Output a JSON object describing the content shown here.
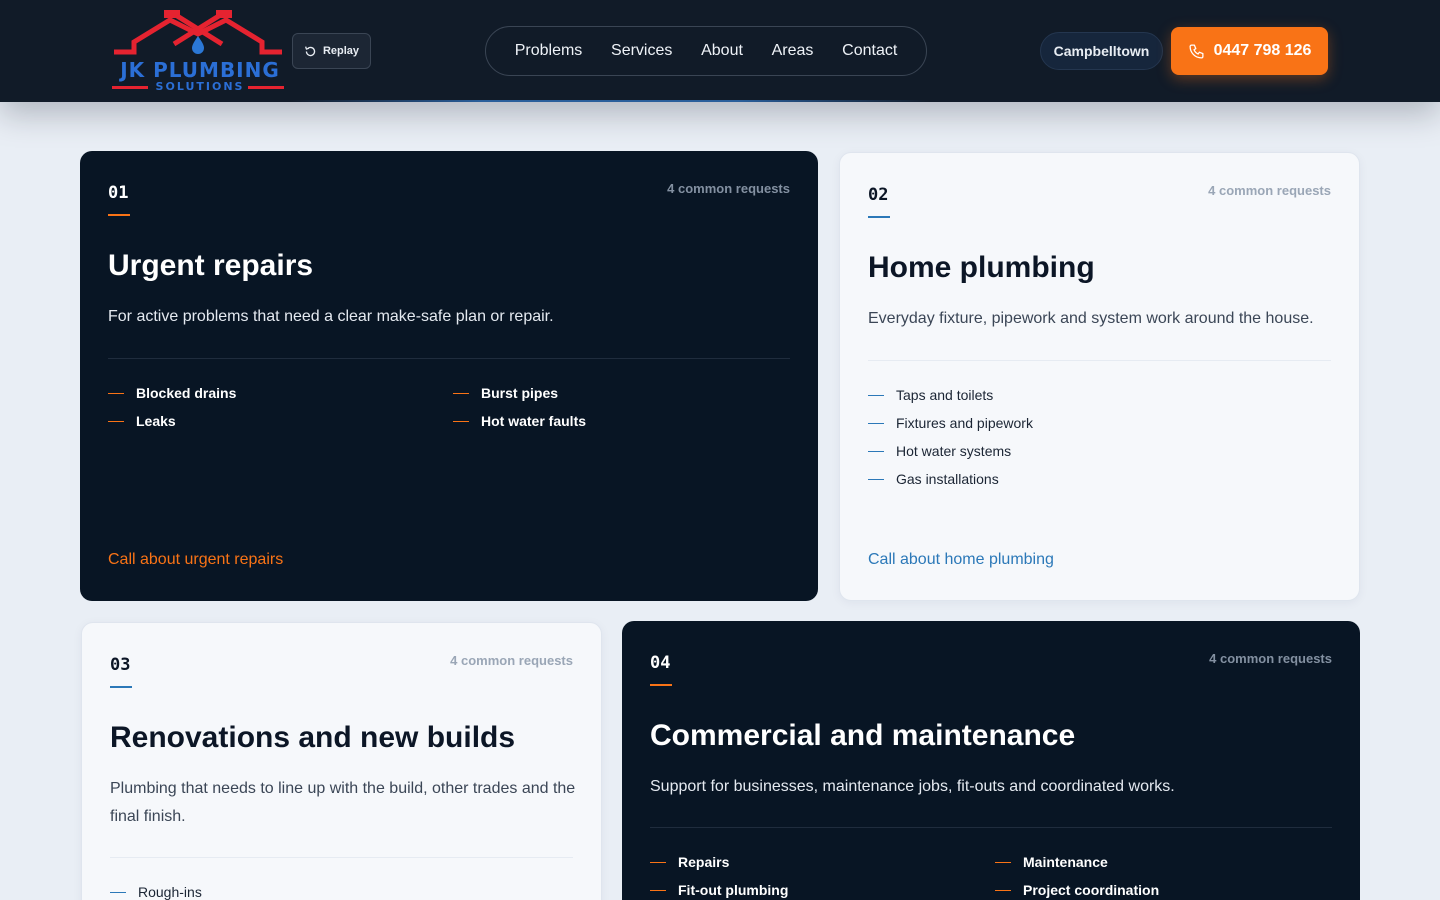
{
  "header": {
    "logo": {
      "name": "JK PLUMBING",
      "sub": "SOLUTIONS"
    },
    "replay_label": "Replay",
    "nav": [
      "Problems",
      "Services",
      "About",
      "Areas",
      "Contact"
    ],
    "location": "Campbelltown",
    "phone": "0447 798 126"
  },
  "cards": [
    {
      "num": "01",
      "count": "4 common requests",
      "title": "Urgent repairs",
      "desc": "For active problems that need a clear make-safe plan or repair.",
      "items": [
        "Blocked drains",
        "Burst pipes",
        "Leaks",
        "Hot water faults"
      ],
      "cta": "Call about urgent repairs"
    },
    {
      "num": "02",
      "count": "4 common requests",
      "title": "Home plumbing",
      "desc": "Everyday fixture, pipework and system work around the house.",
      "items": [
        "Taps and toilets",
        "Fixtures and pipework",
        "Hot water systems",
        "Gas installations"
      ],
      "cta": "Call about home plumbing"
    },
    {
      "num": "03",
      "count": "4 common requests",
      "title": "Renovations and new builds",
      "desc": "Plumbing that needs to line up with the build, other trades and the final finish.",
      "items": [
        "Rough-ins"
      ]
    },
    {
      "num": "04",
      "count": "4 common requests",
      "title": "Commercial and maintenance",
      "desc": "Support for businesses, maintenance jobs, fit-outs and coordinated works.",
      "items": [
        "Repairs",
        "Maintenance",
        "Fit-out plumbing",
        "Project coordination"
      ]
    }
  ]
}
